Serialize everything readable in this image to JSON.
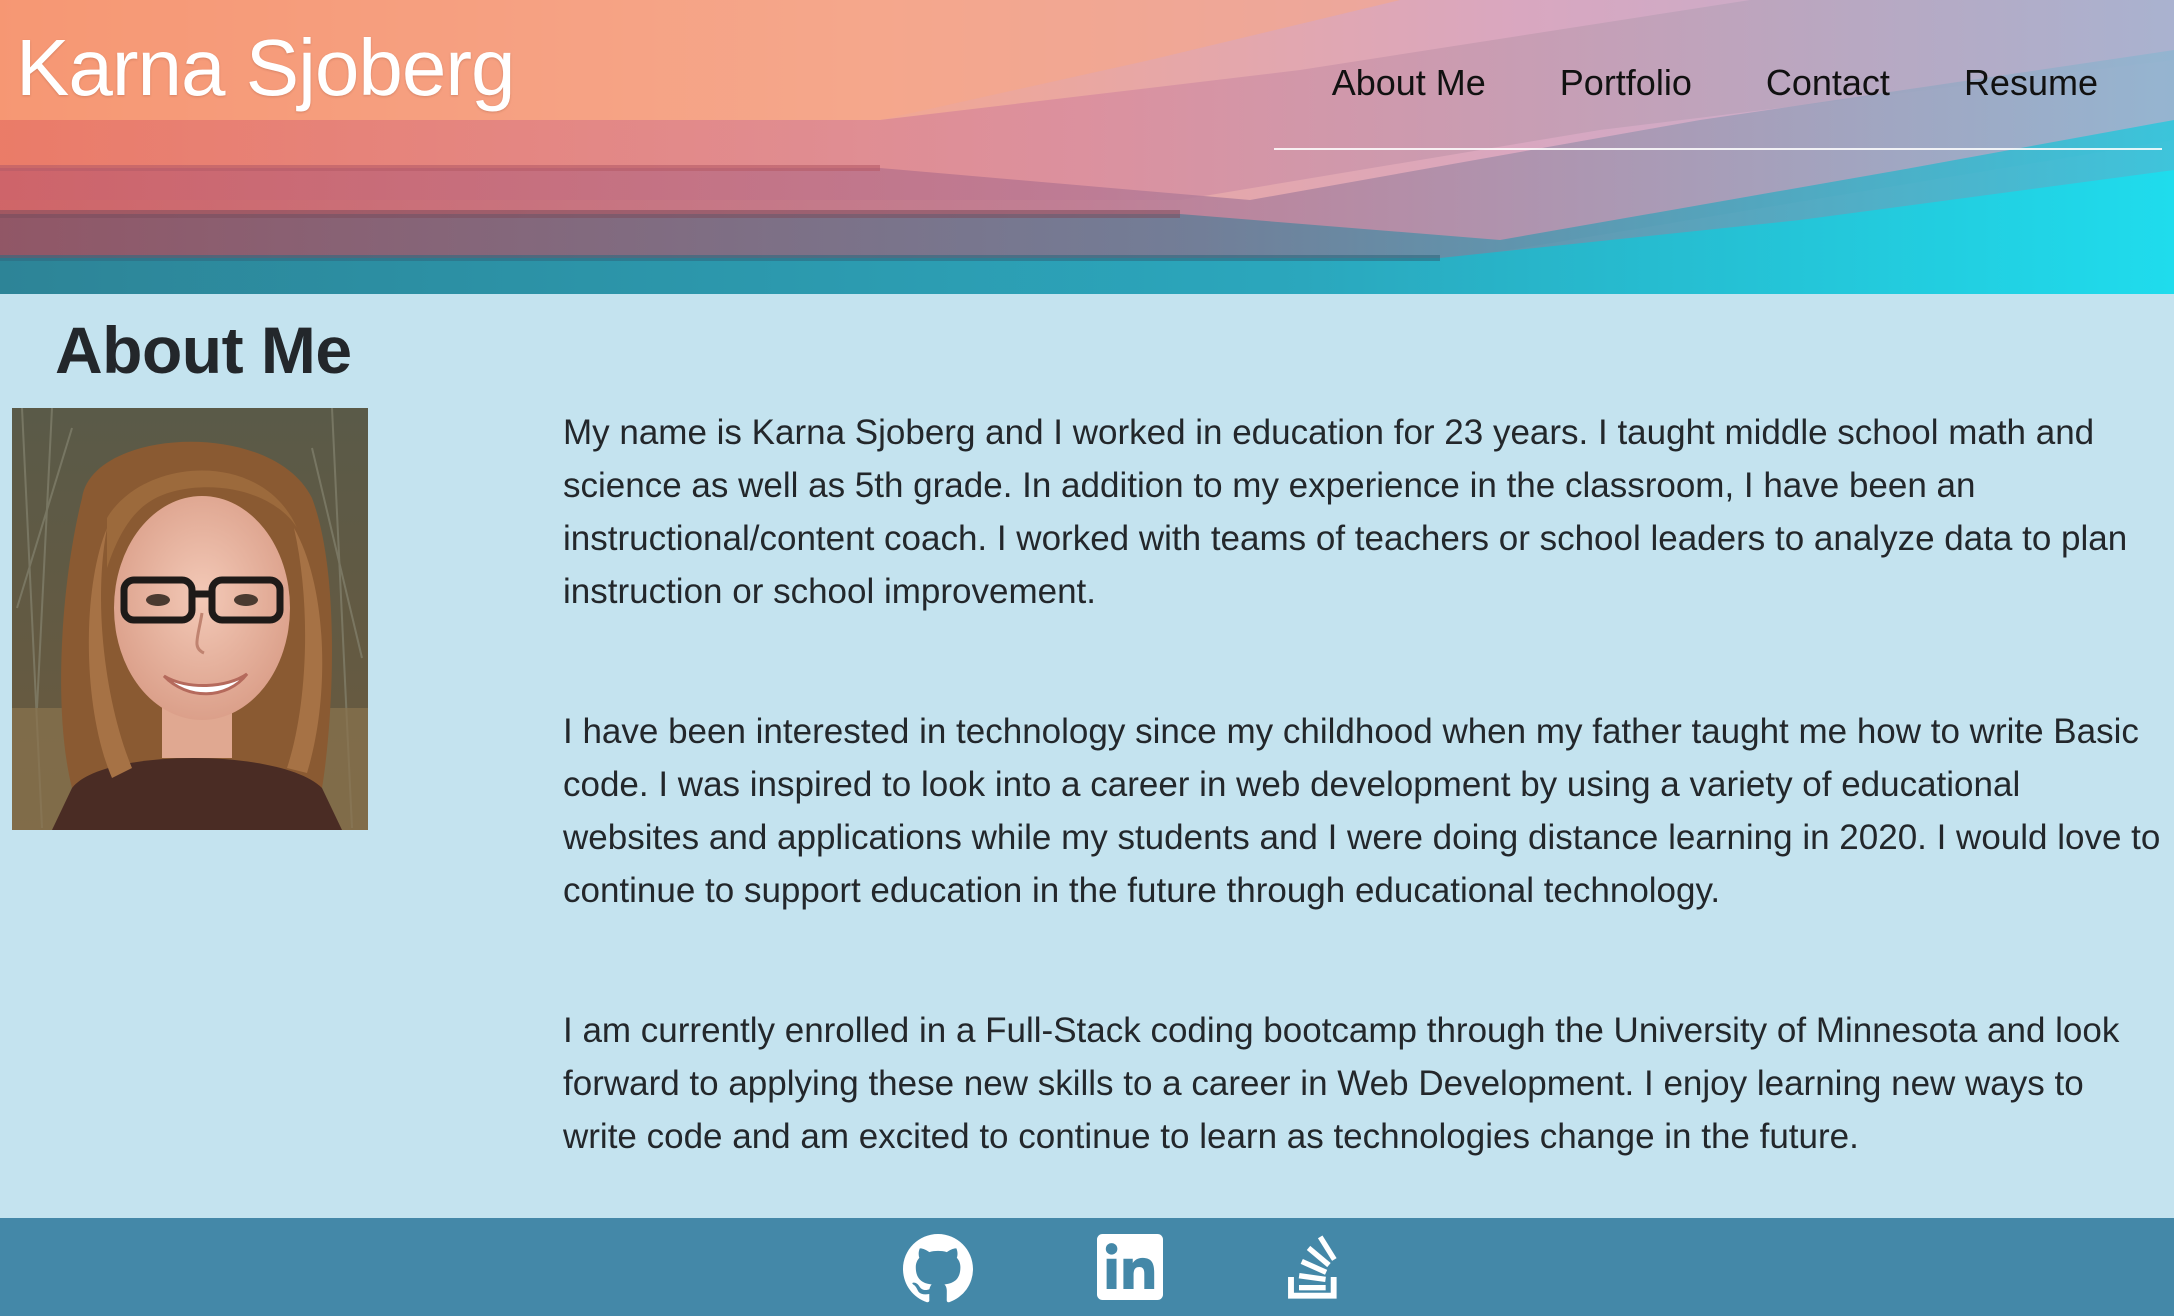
{
  "header": {
    "site_title": "Karna Sjoberg",
    "nav": [
      {
        "label": "About Me"
      },
      {
        "label": "Portfolio"
      },
      {
        "label": "Contact"
      },
      {
        "label": "Resume"
      }
    ]
  },
  "main": {
    "heading": "About Me",
    "paragraphs": [
      "My name is Karna Sjoberg and I worked in education for 23 years. I taught middle school math and science as well as 5th grade. In addition to my experience in the classroom, I have been an instructional/content coach. I worked with teams of teachers or school leaders to analyze data to plan instruction or school improvement.",
      "I have been interested in technology since my childhood when my father taught me how to write Basic code. I was inspired to look into a career in web development by using a variety of educational websites and applications while my students and I were doing distance learning in 2020. I would love to continue to support education in the future through educational technology.",
      "I am currently enrolled in a Full-Stack coding bootcamp through the University of Minnesota and look forward to applying these new skills to a career in Web Development. I enjoy learning new ways to write code and am excited to continue to learn as technologies change in the future."
    ]
  },
  "footer": {
    "links": [
      {
        "icon": "github-icon"
      },
      {
        "icon": "linkedin-icon"
      },
      {
        "icon": "stackoverflow-icon"
      }
    ]
  },
  "colors": {
    "page_background": "#c4e3ef",
    "footer_background": "#4488a8",
    "text": "#23272b"
  }
}
